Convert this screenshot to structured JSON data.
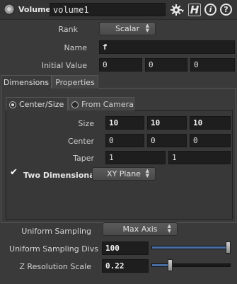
{
  "header": {
    "node_type": "Volume",
    "node_name": "volume1",
    "icons": [
      "gear-icon",
      "help-h-icon",
      "info-icon",
      "question-icon"
    ],
    "h_glyph": "H",
    "info_glyph": "i",
    "help_glyph": "?"
  },
  "params": {
    "rank": {
      "label": "Rank",
      "value": "Scalar"
    },
    "name": {
      "label": "Name",
      "value": "f"
    },
    "initial_value": {
      "label": "Initial Value",
      "values": [
        "0",
        "0",
        "0"
      ]
    }
  },
  "tabs": [
    {
      "label": "Dimensions",
      "active": true
    },
    {
      "label": "Properties",
      "active": false
    }
  ],
  "subtabs": [
    {
      "label": "Center/Size",
      "active": true
    },
    {
      "label": "From Camera",
      "active": false
    }
  ],
  "dimensions": {
    "size": {
      "label": "Size",
      "values": [
        "10",
        "10",
        "10"
      ]
    },
    "center": {
      "label": "Center",
      "values": [
        "0",
        "0",
        "0"
      ]
    },
    "taper": {
      "label": "Taper",
      "values": [
        "1",
        "1"
      ]
    },
    "two_dimensional": {
      "label": "Two Dimensional",
      "checked": true,
      "plane": "XY Plane"
    }
  },
  "sampling": {
    "uniform_sampling": {
      "label": "Uniform Sampling",
      "value": "Max Axis"
    },
    "uniform_sampling_divs": {
      "label": "Uniform Sampling Divs",
      "value": "100",
      "slider_fraction": 1.0
    },
    "z_resolution_scale": {
      "label": "Z Resolution Scale",
      "value": "0.22",
      "slider_fraction": 0.22
    }
  },
  "colors": {
    "background": "#3a3a3a",
    "field": "#1e1e1e",
    "accent": "#4a6fa5"
  }
}
